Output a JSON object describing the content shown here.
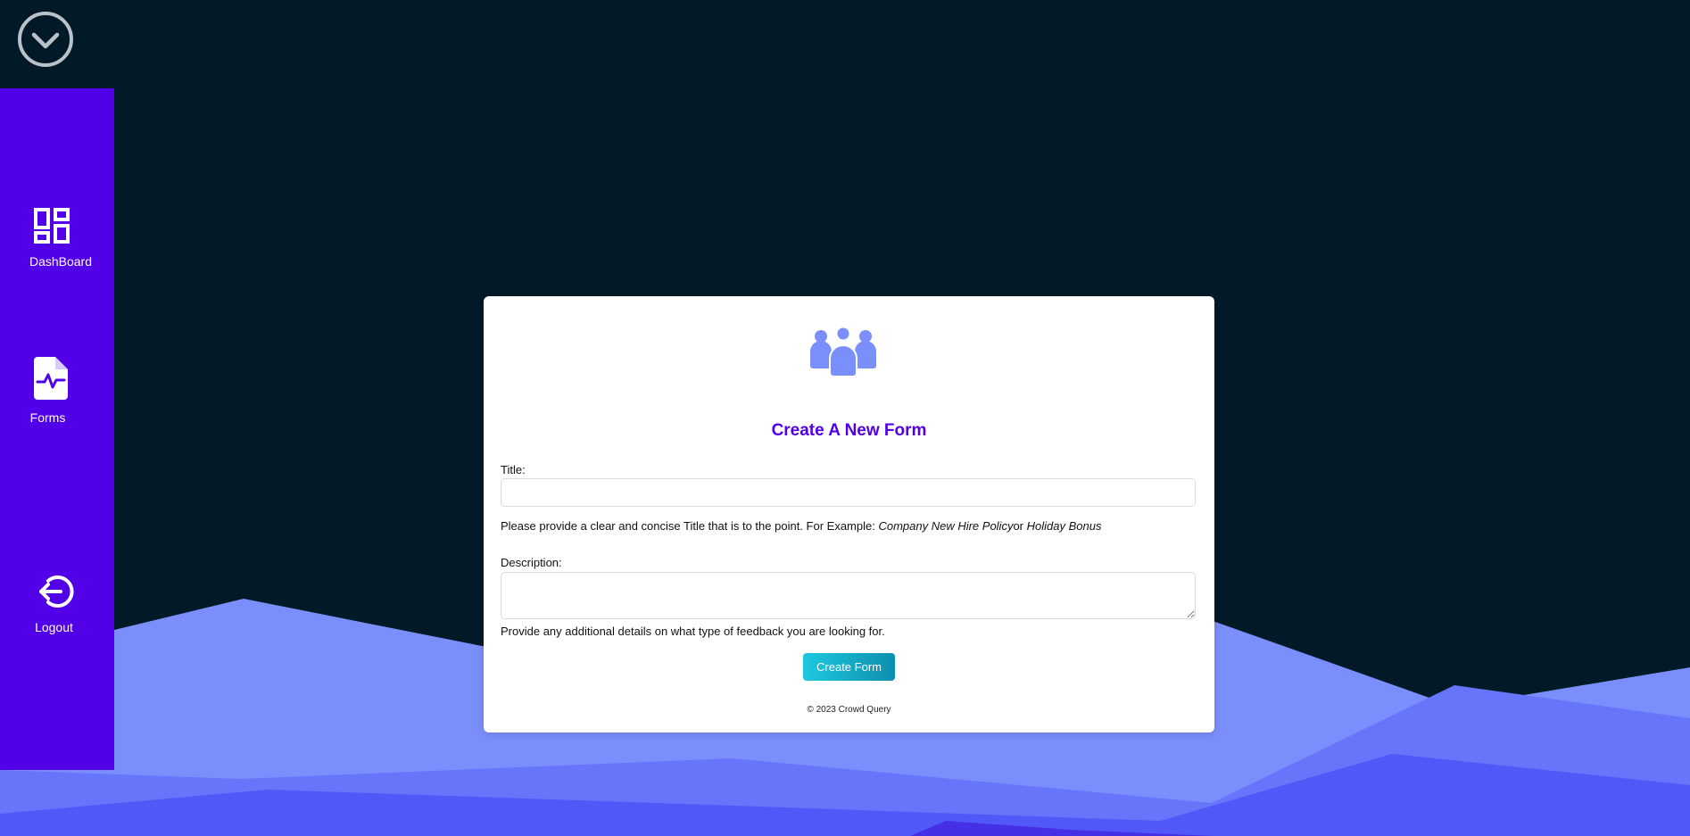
{
  "colors": {
    "background": "#021a28",
    "sidebar": "#5100e8",
    "accent": "#5100e8",
    "button_start": "#1ec8e0",
    "button_end": "#0c8fae",
    "mountain_light": "#7b8ffc",
    "mountain_mid": "#6675fa",
    "mountain_dark": "#5258f7",
    "logo": "#7b8ffc"
  },
  "top_toggle": {
    "icon": "chevron-down-circle-icon"
  },
  "sidebar": {
    "items": [
      {
        "label": "DashBoard",
        "icon": "dashboard-icon"
      },
      {
        "label": "Forms",
        "icon": "file-pulse-icon"
      },
      {
        "label": "Logout",
        "icon": "logout-icon"
      }
    ]
  },
  "card": {
    "logo_icon": "people-group-icon",
    "title": "Create A New Form",
    "title_field": {
      "label": "Title:",
      "value": "",
      "placeholder": "",
      "helper_prefix": "Please provide a clear and concise Title that is to the point. For Example: ",
      "helper_example1": "Company New Hire Policy",
      "helper_or": "or ",
      "helper_example2": "Holiday Bonus"
    },
    "description_field": {
      "label": "Description:",
      "value": "",
      "placeholder": "",
      "helper": "Provide any additional details on what type of feedback you are looking for."
    },
    "submit_label": "Create Form",
    "footer": "© 2023 Crowd Query"
  }
}
